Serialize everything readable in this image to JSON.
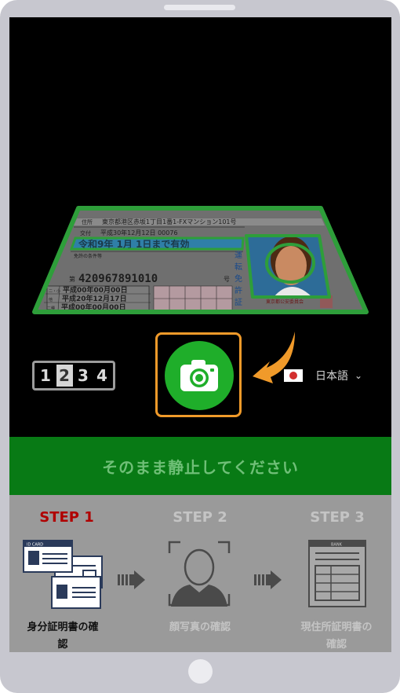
{
  "step_indicator": {
    "numbers": [
      "1",
      "2",
      "3",
      "4"
    ]
  },
  "language": {
    "selected": "日本語"
  },
  "banner": {
    "message": "そのまま静止してください"
  },
  "steps": [
    {
      "title": "STEP 1",
      "label": "身分証明書の確\n認",
      "active": true
    },
    {
      "title": "STEP 2",
      "label": "顔写真の確認",
      "active": false
    },
    {
      "title": "STEP 3",
      "label": "現住所証明書の\n確認",
      "active": false
    }
  ],
  "license": {
    "address": "東京都港区赤坂1丁目1番1-FXマンション101号",
    "issue": "平成30年12月12日 00076",
    "valid": "令和9年 1月 1日まで有効",
    "number_label": "第",
    "number": "420967891010",
    "number_suffix": "号",
    "dates": [
      "平成00年00月00日",
      "平成20年12月17日",
      "平成00年00月00日"
    ],
    "side_text": "運転免許証",
    "issuer": "東京都公安委員会",
    "row_labels": [
      "住所",
      "交付",
      "免許の条件等"
    ],
    "small_labels": [
      "二・小",
      "他",
      "二種"
    ],
    "id_card_text": "ID CARD",
    "bank_text": "BANK"
  },
  "colors": {
    "green_outline": "#2e9e3a",
    "orange": "#f09a2a",
    "step_active": "#b00000",
    "step_inactive": "#c4c4c4",
    "banner_bg": "#087a15"
  }
}
